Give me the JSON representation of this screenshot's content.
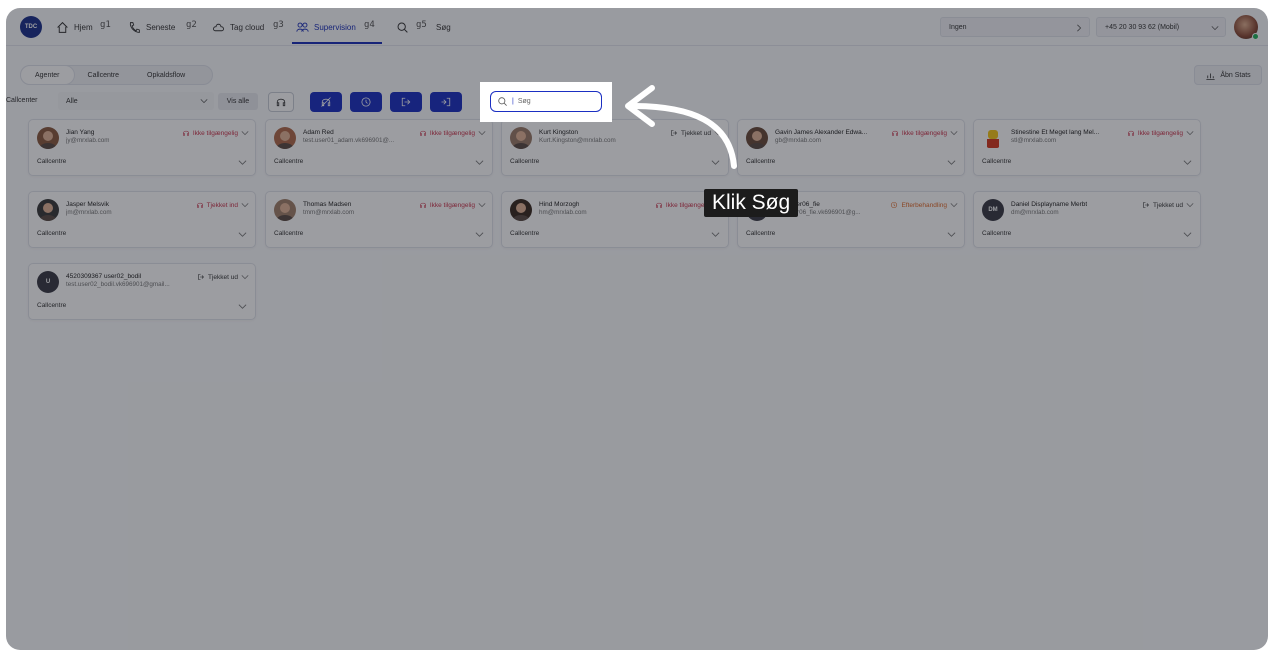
{
  "topbar": {
    "logo_text": "TDC",
    "nav": [
      {
        "label": "Hjem",
        "key": "g1"
      },
      {
        "label": "Seneste",
        "key": "g2"
      },
      {
        "label": "Tag cloud",
        "key": "g3"
      },
      {
        "label": "Supervision",
        "key": "g4"
      },
      {
        "label": "Søg",
        "key": "g5"
      }
    ],
    "status_select": "Ingen",
    "phone_select": "+45 20 30 93 62 (Mobil)"
  },
  "toolbar": {
    "tabs": [
      "Agenter",
      "Callcentre",
      "Opkaldsflow"
    ],
    "abn_stats": "Åbn Stats",
    "callcenter_label": "Callcenter",
    "callcenter_value": "Alle",
    "vis_alle": "Vis alle",
    "search_placeholder": "Søg"
  },
  "status_colors": {
    "red": "#c8324a",
    "dark": "#333333",
    "orange": "#e06a2a",
    "accent": "#1b2fc2"
  },
  "agents": [
    {
      "name": "Jian Yang",
      "email": "jy@mrxlab.com",
      "status": "Ikke tilgængelig",
      "kind": "red",
      "callcentre": "Callcentre",
      "avatar": "photo"
    },
    {
      "name": "Adam Red",
      "email": "test.user01_adam.vk696901@...",
      "status": "Ikke tilgængelig",
      "kind": "red",
      "callcentre": "Callcentre",
      "avatar": "photo"
    },
    {
      "name": "Kurt Kingston",
      "email": "Kurt.Kingston@mrxlab.com",
      "status": "Tjekket ud",
      "kind": "dark",
      "callcentre": "Callcentre",
      "avatar": "photo"
    },
    {
      "name": "Gavin James Alexander Edwa...",
      "email": "gb@mrxlab.com",
      "status": "Ikke tilgængelig",
      "kind": "red",
      "callcentre": "Callcentre",
      "avatar": "photo"
    },
    {
      "name": "Stinestine Et Meget lang Mel...",
      "email": "stl@mrxlab.com",
      "status": "Ikke tilgængelig",
      "kind": "red",
      "callcentre": "Callcentre",
      "avatar": "lego"
    },
    {
      "name": "Jasper Melsvik",
      "email": "jm@mrxlab.com",
      "status": "Tjekket ind",
      "kind": "red",
      "callcentre": "Callcentre",
      "avatar": "photo"
    },
    {
      "name": "Thomas Madsen",
      "email": "tmm@mrxlab.com",
      "status": "Ikke tilgængelig",
      "kind": "red",
      "callcentre": "Callcentre",
      "avatar": "photo"
    },
    {
      "name": "Hind Morzogh",
      "email": "hm@mrxlab.com",
      "status": "Ikke tilgængelig",
      "kind": "red",
      "callcentre": "Callcentre",
      "avatar": "photo"
    },
    {
      "name": "...85 user06_fie",
      "email": "test.user06_fie.vk696901@g...",
      "status": "Efterbehandling",
      "kind": "orange",
      "callcentre": "Callcentre",
      "avatar": "U"
    },
    {
      "name": "Daniel Displayname Merbt",
      "email": "dm@mrxlab.com",
      "status": "Tjekket ud",
      "kind": "dark",
      "callcentre": "Callcentre",
      "avatar": "DM"
    },
    {
      "name": "4520309367 user02_bodil",
      "email": "test.user02_bodil.vk696901@gmail...",
      "status": "Tjekket ud",
      "kind": "dark",
      "callcentre": "Callcentre",
      "avatar": "U"
    }
  ],
  "annotation": {
    "label": "Klik Søg"
  }
}
